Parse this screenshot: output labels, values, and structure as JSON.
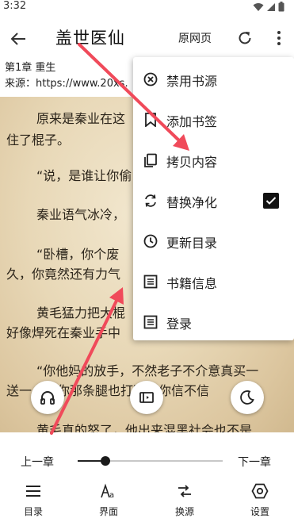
{
  "status_bar": {
    "time": "3:32"
  },
  "toolbar": {
    "title": "盖世医仙",
    "origin_label": "原网页"
  },
  "chapter_info": {
    "chapter": "第1章 重生",
    "source": "来源：https://www.20xs."
  },
  "content": {
    "paragraphs": [
      "原来是秦业在这",
      "住了棍子。",
      "“说，是谁让你偷",
      "秦业语气冰冷，",
      "“卧槽，你个废",
      "久，你竟然还有力气",
      "黄毛猛力把大棍",
      "好像焊死在秦业手中",
      "“你他妈的放手，不然老子不介意真买一",
      "送一，把你那条腿也打断，你信不信",
      "黄毛真的怒了，他出来混黑社会也不是"
    ]
  },
  "menu": {
    "items": [
      {
        "label": "禁用书源",
        "icon": "block-icon"
      },
      {
        "label": "添加书签",
        "icon": "bookmark-icon"
      },
      {
        "label": "拷贝内容",
        "icon": "copy-icon"
      },
      {
        "label": "替换净化",
        "icon": "replace-icon",
        "checked": true
      },
      {
        "label": "更新目录",
        "icon": "history-icon"
      },
      {
        "label": "书籍信息",
        "icon": "book-info-icon"
      },
      {
        "label": "登录",
        "icon": "login-icon"
      }
    ]
  },
  "bottom": {
    "prev_chapter": "上一章",
    "next_chapter": "下一章",
    "progress_fraction": 0.19,
    "nav": [
      {
        "label": "目录",
        "icon": "menu-list-icon"
      },
      {
        "label": "界面",
        "icon": "font-style-icon"
      },
      {
        "label": "换源",
        "icon": "swap-source-icon"
      },
      {
        "label": "设置",
        "icon": "settings-icon"
      }
    ]
  },
  "floating_buttons": [
    "headphones-icon",
    "auto-page-icon",
    "night-mode-icon"
  ],
  "colors": {
    "annotation_arrow": "#f04a5a",
    "reader_background": "#e8d8b7",
    "accent": "#111111"
  }
}
